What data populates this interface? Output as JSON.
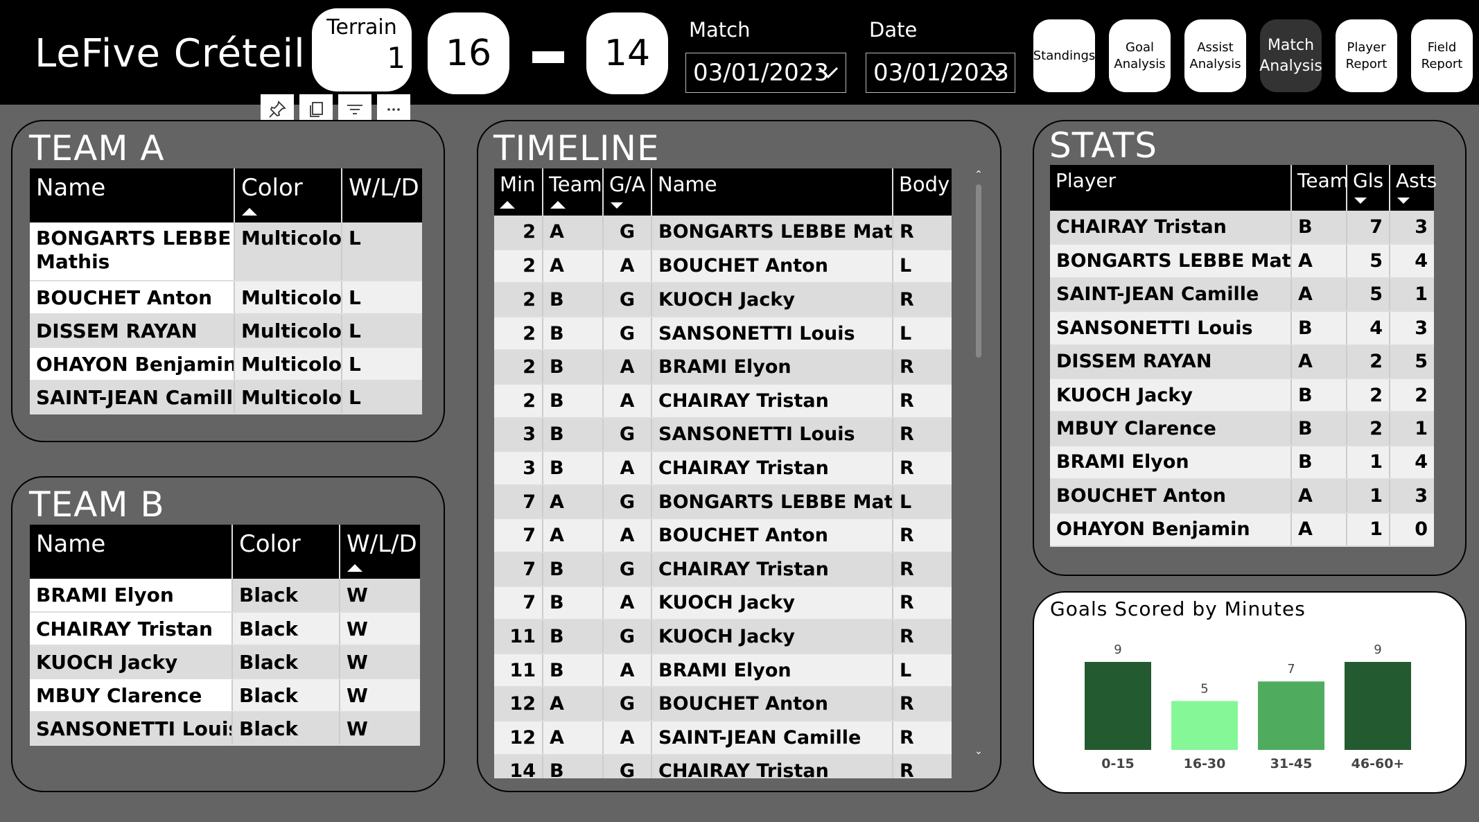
{
  "header": {
    "title": "LeFive Créteil",
    "terrain_label": "Terrain",
    "terrain_value": "1",
    "score_a": "16",
    "score_b": "14",
    "match_label": "Match",
    "match_value": "03/01/2023",
    "date_label": "Date",
    "date_value": "03/01/2023"
  },
  "nav": [
    {
      "label": "Standings"
    },
    {
      "label": "Goal Analysis"
    },
    {
      "label": "Assist Analysis"
    },
    {
      "label": "Match Analysis"
    },
    {
      "label": "Player Report"
    },
    {
      "label": "Field Report"
    }
  ],
  "visual_header": {
    "icons": [
      "pin-icon",
      "copy-icon",
      "filter-icon",
      "more-options-icon"
    ]
  },
  "team_a": {
    "title": "TEAM A",
    "columns": [
      "Name",
      "Color",
      "W/L/D"
    ],
    "rows": [
      [
        "BONGARTS LEBBE Mathis",
        "Multicolor",
        "L"
      ],
      [
        "BOUCHET Anton",
        "Multicolor",
        "L"
      ],
      [
        "DISSEM RAYAN",
        "Multicolor",
        "L"
      ],
      [
        "OHAYON Benjamin",
        "Multicolor",
        "L"
      ],
      [
        "SAINT-JEAN Camille",
        "Multicolor",
        "L"
      ]
    ]
  },
  "team_b": {
    "title": "TEAM B",
    "columns": [
      "Name",
      "Color",
      "W/L/D"
    ],
    "rows": [
      [
        "BRAMI Elyon",
        "Black",
        "W"
      ],
      [
        "CHAIRAY Tristan",
        "Black",
        "W"
      ],
      [
        "KUOCH Jacky",
        "Black",
        "W"
      ],
      [
        "MBUY Clarence",
        "Black",
        "W"
      ],
      [
        "SANSONETTI Louis",
        "Black",
        "W"
      ]
    ]
  },
  "timeline": {
    "title": "TIMELINE",
    "columns": [
      "Min",
      "Team",
      "G/A",
      "Name",
      "Body"
    ],
    "rows": [
      [
        "2",
        "A",
        "G",
        "BONGARTS LEBBE Mathis",
        "R"
      ],
      [
        "2",
        "A",
        "A",
        "BOUCHET Anton",
        "L"
      ],
      [
        "2",
        "B",
        "G",
        "KUOCH Jacky",
        "R"
      ],
      [
        "2",
        "B",
        "G",
        "SANSONETTI Louis",
        "L"
      ],
      [
        "2",
        "B",
        "A",
        "BRAMI Elyon",
        "R"
      ],
      [
        "2",
        "B",
        "A",
        "CHAIRAY Tristan",
        "R"
      ],
      [
        "3",
        "B",
        "G",
        "SANSONETTI Louis",
        "R"
      ],
      [
        "3",
        "B",
        "A",
        "CHAIRAY Tristan",
        "R"
      ],
      [
        "7",
        "A",
        "G",
        "BONGARTS LEBBE Mathis",
        "L"
      ],
      [
        "7",
        "A",
        "A",
        "BOUCHET Anton",
        "R"
      ],
      [
        "7",
        "B",
        "G",
        "CHAIRAY Tristan",
        "R"
      ],
      [
        "7",
        "B",
        "A",
        "KUOCH Jacky",
        "R"
      ],
      [
        "11",
        "B",
        "G",
        "KUOCH Jacky",
        "R"
      ],
      [
        "11",
        "B",
        "A",
        "BRAMI Elyon",
        "L"
      ],
      [
        "12",
        "A",
        "G",
        "BOUCHET Anton",
        "R"
      ],
      [
        "12",
        "A",
        "A",
        "SAINT-JEAN Camille",
        "R"
      ],
      [
        "14",
        "B",
        "G",
        "CHAIRAY Tristan",
        "R"
      ]
    ]
  },
  "stats": {
    "title": "STATS",
    "columns": [
      "Player",
      "Team",
      "Gls",
      "Asts"
    ],
    "rows": [
      [
        "CHAIRAY Tristan",
        "B",
        "7",
        "3"
      ],
      [
        "BONGARTS LEBBE Mathis",
        "A",
        "5",
        "4"
      ],
      [
        "SAINT-JEAN Camille",
        "A",
        "5",
        "1"
      ],
      [
        "SANSONETTI Louis",
        "B",
        "4",
        "3"
      ],
      [
        "DISSEM RAYAN",
        "A",
        "2",
        "5"
      ],
      [
        "KUOCH Jacky",
        "B",
        "2",
        "2"
      ],
      [
        "MBUY Clarence",
        "B",
        "2",
        "1"
      ],
      [
        "BRAMI Elyon",
        "B",
        "1",
        "4"
      ],
      [
        "BOUCHET Anton",
        "A",
        "1",
        "3"
      ],
      [
        "OHAYON Benjamin",
        "A",
        "1",
        "0"
      ]
    ]
  },
  "chart_data": {
    "type": "bar",
    "title": "Goals Scored by Minutes",
    "categories": [
      "0-15",
      "16-30",
      "31-45",
      "46-60+"
    ],
    "values": [
      9,
      5,
      7,
      9
    ],
    "colors": [
      "#245a2f",
      "#86f797",
      "#4fac5e",
      "#245a2f"
    ],
    "ylim": [
      0,
      9
    ],
    "legend": false,
    "grid": false,
    "data_labels": true
  }
}
